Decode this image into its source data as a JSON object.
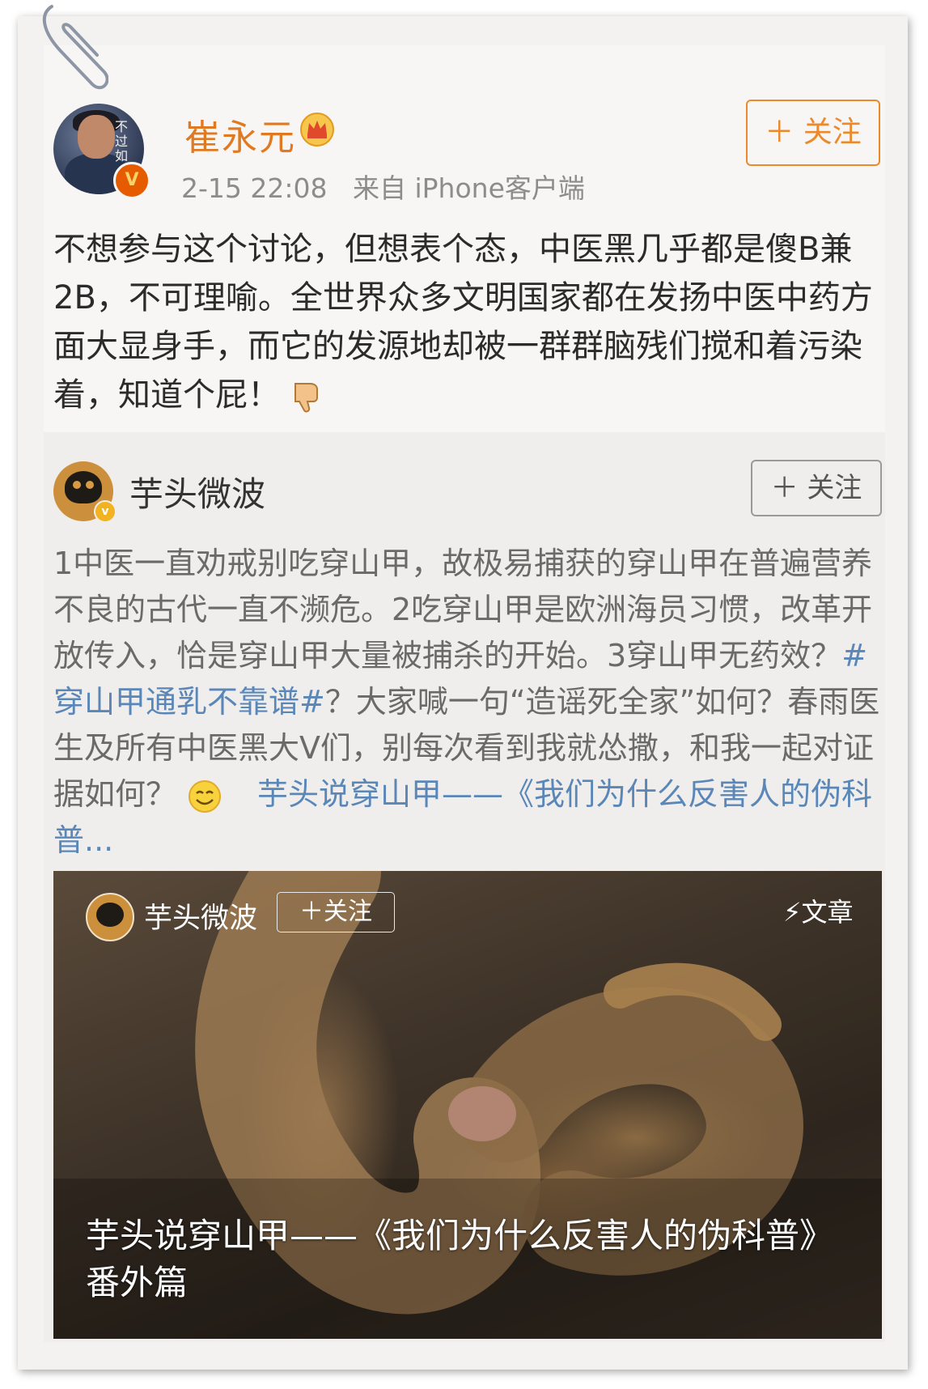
{
  "post": {
    "author": "崔永元",
    "time": "2-15 22:08",
    "source": "来自 iPhone客户端",
    "follow_label": "＋ 关注",
    "text": "不想参与这个讨论，但想表个态，中医黑几乎都是傻B兼2B，不可理喻。全世界众多文明国家都在发扬中医中药方面大显身手，而它的发源地却被一群群脑残们搅和着污染着，知道个屁！",
    "avatar_sign": "不\n过\n如",
    "verified_badge": "V",
    "icons": [
      "crown-icon",
      "thumbs-down-icon"
    ]
  },
  "repost": {
    "author": "芋头微波",
    "follow_label": "＋ 关注",
    "text_part1": "1中医一直劝戒别吃穿山甲，故极易捕获的穿山甲在普遍营养不良的古代一直不濒危。2吃穿山甲是欧洲海员习惯，改革开放传入，恰是穿山甲大量被捕杀的开始。3穿山甲无药效？",
    "hashtag": "#穿山甲通乳不靠谱#",
    "text_part2": "？大家喊一句“造谣死全家”如何？春雨医生及所有中医黑大V们，别每次看到我就怂撒，和我一起对证据如何？",
    "link": "芋头说穿山甲——《我们为什么反害人的伪科普...",
    "icons": [
      "smile-emoji-icon"
    ]
  },
  "card": {
    "author": "芋头微波",
    "follow_label": "＋关注",
    "tag": "文章",
    "title": "芋头说穿山甲——《我们为什么反害人的伪科普》番外篇",
    "icons": [
      "lightning-icon"
    ]
  }
}
